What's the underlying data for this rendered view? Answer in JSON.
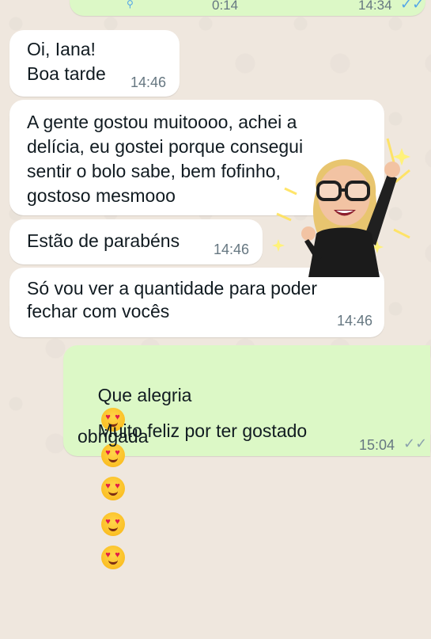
{
  "top_bubble": {
    "time_left": "0:14",
    "time_right": "14:34"
  },
  "messages": [
    {
      "type": "incoming",
      "lines": [
        "Oi, Iana!",
        "Boa tarde"
      ],
      "time": "14:46"
    },
    {
      "type": "incoming",
      "lines": [
        "A gente gostou muitoooo, achei a",
        "delícia, eu gostei porque consegui",
        "sentir o bolo sabe, bem fofinho,",
        "gostoso mesmooo"
      ]
    },
    {
      "type": "incoming",
      "lines": [
        "Estão de parabéns"
      ],
      "time": "14:46"
    },
    {
      "type": "incoming",
      "lines": [
        "Só vou ver a quantidade para poder",
        "fechar com vocês"
      ],
      "time": "14:46"
    },
    {
      "type": "outgoing",
      "lines": [
        "Que alegria",
        "Muito feliz por ter gostado",
        "obrigada"
      ],
      "time": "15:04",
      "status": "read"
    }
  ],
  "emojis": {
    "line1": [
      "heart-eyes-icon",
      "heart-eyes-icon",
      "heart-eyes-icon"
    ],
    "line2": [
      "heart-eyes-icon",
      "heart-eyes-icon"
    ]
  },
  "sticker": "memoji-celebrating-sticker",
  "colors": {
    "incoming": "#ffffff",
    "outgoing": "#dcf8c6",
    "read_check": "#53a6e8"
  }
}
